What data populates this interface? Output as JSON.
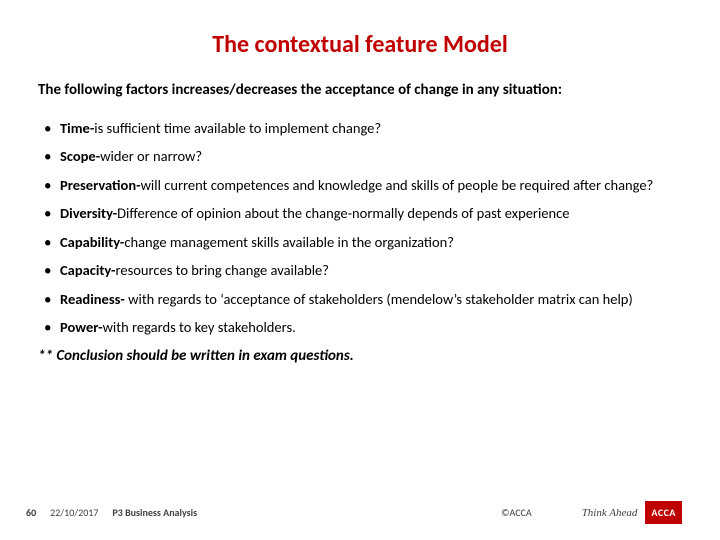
{
  "title": "The contextual feature Model",
  "intro": "The following factors increases/decreases the acceptance of change in any situation:",
  "bullets": [
    {
      "term": " Time-",
      "desc": "is sufficient time available to implement change?"
    },
    {
      "term": "Scope-",
      "desc": "wider or narrow?"
    },
    {
      "term": "Preservation-",
      "desc": "will current competences and knowledge and skills of people be required after change?"
    },
    {
      "term": "Diversity-",
      "desc": "Difference of opinion about the change-normally depends of past experience"
    },
    {
      "term": "Capability-",
      "desc": "change management skills available in the organization?"
    },
    {
      "term": "Capacity-",
      "desc": "resources to bring change available?"
    },
    {
      "term": " Readiness-",
      "desc": " with regards to ‘acceptance of stakeholders (mendelow’s stakeholder matrix can help)"
    },
    {
      "term": "Power-",
      "desc": "with regards to key stakeholders."
    }
  ],
  "conclusion": "** Conclusion should be written in exam questions.",
  "footer": {
    "page": "60",
    "date": "22/10/2017",
    "course": "P3  Business Analysis",
    "copyright": "©ACCA",
    "think": "Think Ahead",
    "badge": "ACCA"
  }
}
